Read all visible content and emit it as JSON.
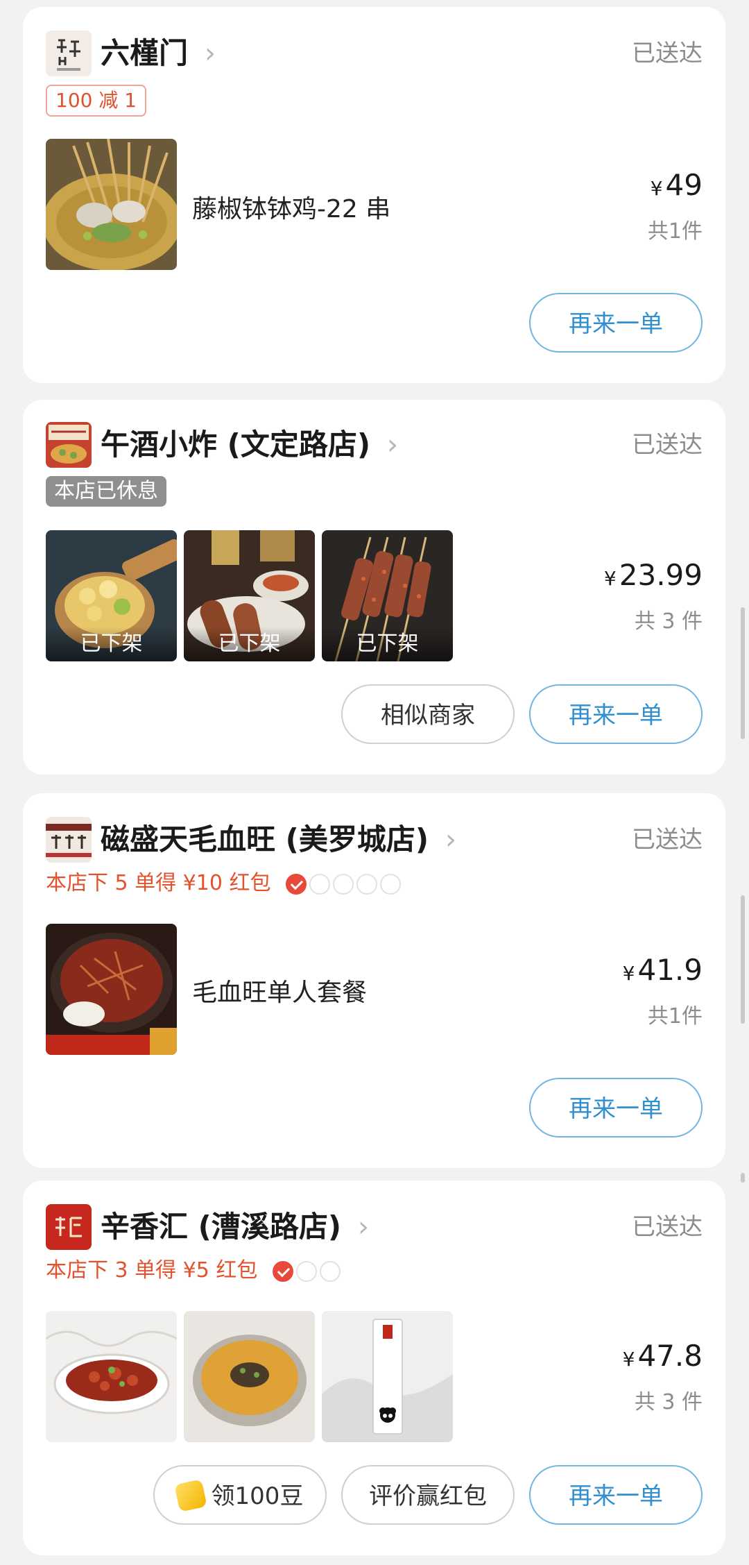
{
  "orders": [
    {
      "shop_name": "六槿门",
      "status": "已送达",
      "tag": "100 减 1",
      "items": [
        {
          "name": "藤椒钵钵鸡-22 串"
        }
      ],
      "price_symbol": "¥",
      "price": "49",
      "count": "共1件",
      "buttons": {
        "reorder": "再来一单"
      }
    },
    {
      "shop_name": "午酒小炸 (文定路店)",
      "status": "已送达",
      "tag": "本店已休息",
      "items": [
        {
          "label": "已下架"
        },
        {
          "label": "已下架"
        },
        {
          "label": "已下架"
        }
      ],
      "price_symbol": "¥",
      "price": "23.99",
      "count": "共 3 件",
      "buttons": {
        "similar": "相似商家",
        "reorder": "再来一单"
      }
    },
    {
      "shop_name": "磁盛天毛血旺 (美罗城店)",
      "status": "已送达",
      "promo": "本店下 5 单得 ¥10 红包",
      "promo_progress": {
        "done": 1,
        "total": 5
      },
      "items": [
        {
          "name": "毛血旺单人套餐"
        }
      ],
      "price_symbol": "¥",
      "price": "41.9",
      "count": "共1件",
      "buttons": {
        "reorder": "再来一单"
      }
    },
    {
      "shop_name": "辛香汇 (漕溪路店)",
      "status": "已送达",
      "promo": "本店下 3 单得 ¥5 红包",
      "promo_progress": {
        "done": 1,
        "total": 3
      },
      "price_symbol": "¥",
      "price": "47.8",
      "count": "共 3 件",
      "buttons": {
        "beans": "领100豆",
        "review": "评价赢红包",
        "reorder": "再来一单"
      }
    }
  ],
  "colors": {
    "accent_blue": "#2f8fd0",
    "promo_red": "#e2522c",
    "status_grey": "#8c8c8c"
  },
  "icons": [
    "chevron-right-icon",
    "check-icon",
    "bean-icon"
  ]
}
